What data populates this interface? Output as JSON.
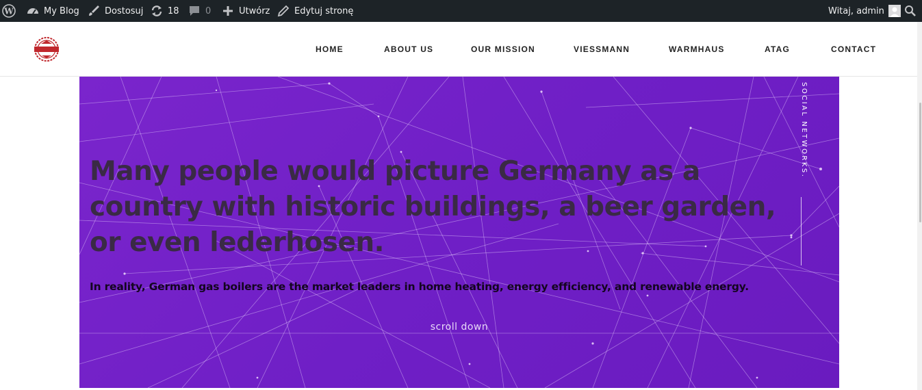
{
  "adminbar": {
    "wp_icon": "wordpress-logo-icon",
    "site_name": "My Blog",
    "customize": "Dostosuj",
    "updates_count": "18",
    "comments_count": "0",
    "new_label": "Utwórz",
    "edit_label": "Edytuj stronę",
    "greeting": "Witaj, admin",
    "avatar_icon": "avatar-icon",
    "search_icon": "search-icon"
  },
  "header": {
    "logo_icon": "ultimate-badge-logo",
    "nav": [
      {
        "label": "HOME"
      },
      {
        "label": "ABOUT US"
      },
      {
        "label": "OUR MISSION"
      },
      {
        "label": "VIESSMANN"
      },
      {
        "label": "WARMHAUS"
      },
      {
        "label": "ATAG"
      },
      {
        "label": "CONTACT"
      }
    ]
  },
  "hero": {
    "headline": "Many people would picture Germany as a country with historic buildings, a beer garden, or even lederhosen.",
    "subline": "In reality, German gas boilers are the market leaders in home heating, energy efficiency, and renewable energy.",
    "scroll_label": "scroll down",
    "social_label": "SOCIAL NETWORKS.",
    "bg_color": "#7022c8",
    "headline_color": "#3a2a45"
  }
}
